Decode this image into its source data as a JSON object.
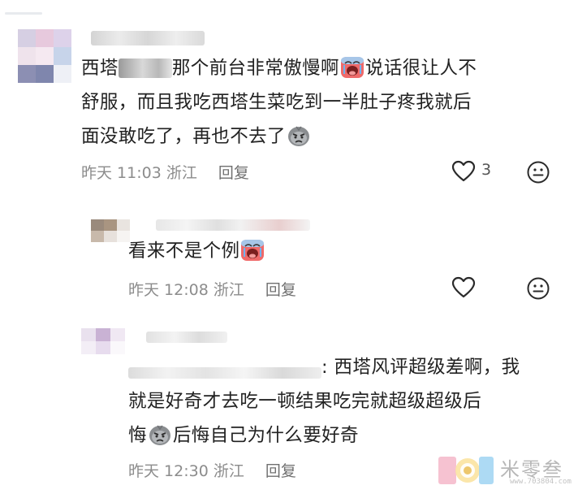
{
  "comments": [
    {
      "text_line1_pre": "西塔",
      "text_line1_post": "那个前台非常傲慢啊",
      "text_line1_tail": "说话很让人不",
      "text_line2": "舒服，而且我吃西塔生菜吃到一半肚子疼我就后",
      "text_line3": "面没敢吃了，再也不去了",
      "time": "昨天 11:03",
      "location": "浙江",
      "reply_label": "回复",
      "like_count": "3"
    },
    {
      "text": "看来不是个例",
      "time": "昨天 12:08",
      "location": "浙江",
      "reply_label": "回复"
    },
    {
      "text_line1": ": 西塔风评超级差啊，我",
      "text_line2": "就是好奇才去吃一顿结果吃完就超级超级后",
      "text_line3_pre": "悔",
      "text_line3_post": "后悔自己为什么要好奇",
      "time": "昨天 12:30",
      "location": "浙江",
      "reply_label": "回复"
    }
  ],
  "icons": {
    "like": "heart-outline-icon",
    "emoji": "smiley-face-icon",
    "emoji_crying": "crying-face-emoji",
    "emoji_grumpy": "grumpy-face-emoji"
  },
  "watermark": {
    "name": "米零叁",
    "url": "www.703804.com"
  }
}
